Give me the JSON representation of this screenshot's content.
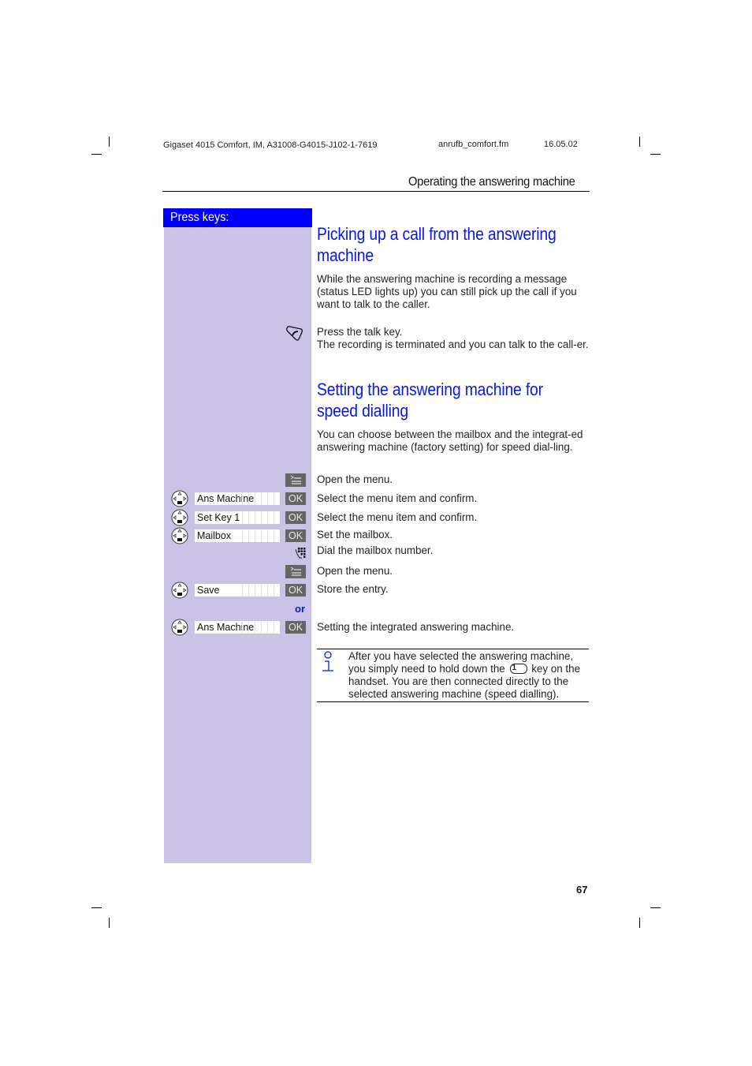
{
  "header": {
    "doc_id": "Gigaset 4015 Comfort, IM, A31008-G4015-J102-1-7619",
    "file_name": "anrufb_comfort.fm",
    "date": "16.05.02",
    "section_title": "Operating the answering machine"
  },
  "sidebar": {
    "heading": "Press keys:",
    "bg_color": "#cbc3e6",
    "heading_color": "#0000ff"
  },
  "section1": {
    "title_line1": "Picking up a call from the answering",
    "title_line2": "machine",
    "intro": "While the answering machine is recording a message (status LED lights up) you can still pick up the call if you want to talk to the caller.",
    "step_talk": {
      "icon": "talk-key-icon",
      "line1": "Press the talk key.",
      "line2": "The recording is terminated and you can talk to the call-er."
    }
  },
  "section2": {
    "title_line1": "Setting the answering machine for",
    "title_line2": "speed dialling",
    "intro": "You can choose between the mailbox and the integrat-ed answering machine (factory setting) for speed dial-ling.",
    "steps": [
      {
        "icon": "menu-key-icon",
        "text": "Open the menu."
      },
      {
        "icon": "nav-key-icon",
        "field": "Ans Machine",
        "button": "OK",
        "text": "Select the menu item and confirm."
      },
      {
        "icon": "nav-key-icon",
        "field": "Set Key 1",
        "button": "OK",
        "text": "Select the menu item and confirm."
      },
      {
        "icon": "nav-key-icon",
        "field": "Mailbox",
        "button": "OK",
        "text": "Set the mailbox."
      },
      {
        "icon": "keypad-icon",
        "text": "Dial the mailbox number."
      },
      {
        "icon": "menu-key-icon",
        "text": "Open the menu."
      },
      {
        "icon": "nav-key-icon",
        "field": "Save",
        "button": "OK",
        "text": "Store the entry."
      },
      {
        "or_label": "or"
      },
      {
        "icon": "nav-key-icon",
        "field": "Ans Machine",
        "button": "OK",
        "text": "Setting the integrated answering machine."
      }
    ]
  },
  "note": {
    "icon": "info-icon",
    "text_before_key": "After you have selected the answering machine, you simply need to hold down the",
    "key_label": "1",
    "text_after_key": "key on the handset. You are then connected directly to the selected answering machine (speed dialling)."
  },
  "page_number": "67",
  "accent_color": "#0a16e8"
}
